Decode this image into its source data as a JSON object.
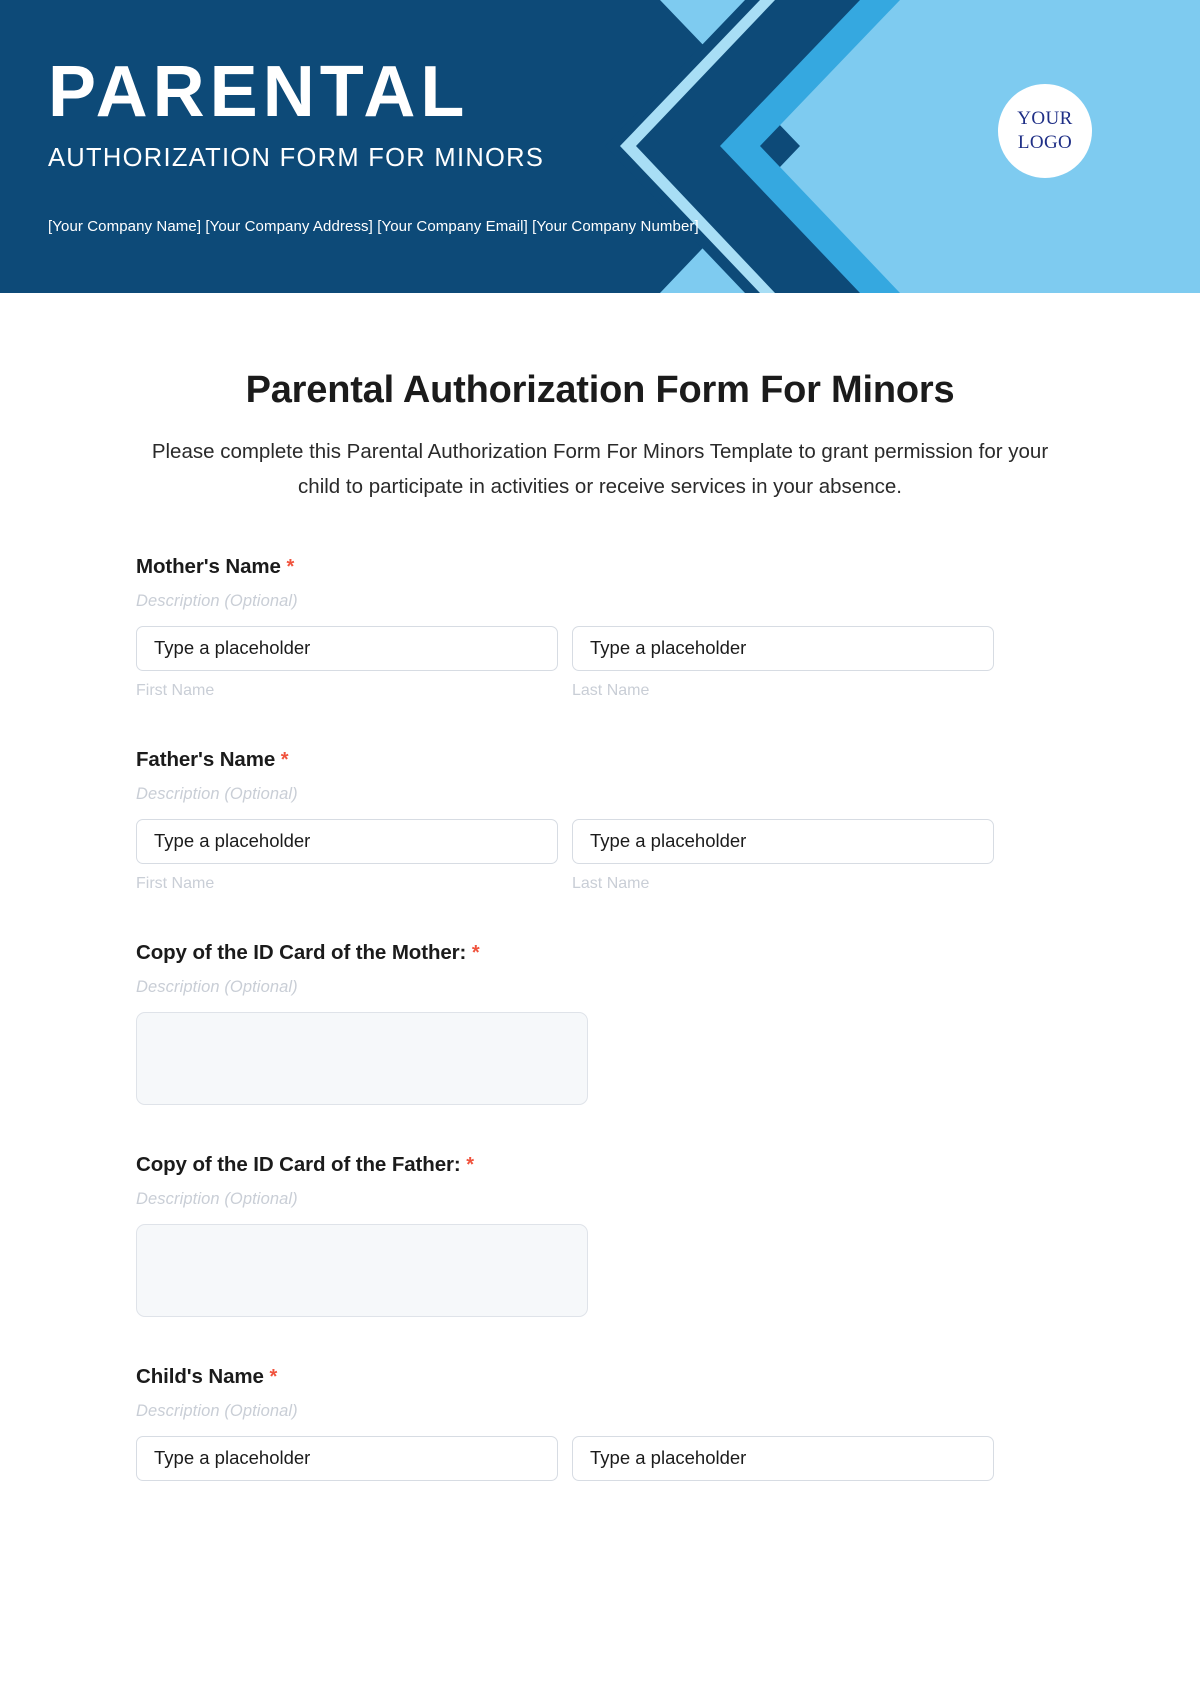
{
  "header": {
    "brand_title": "PARENTAL",
    "brand_subtitle": "AUTHORIZATION FORM FOR MINORS",
    "company_info": "[Your Company Name] [Your Company Address] [Your Company Email] [Your Company Number]",
    "logo_line1": "YOUR",
    "logo_line2": "LOGO",
    "colors": {
      "dark_blue": "#0d4a78",
      "mid_blue": "#35a8e0",
      "light_blue": "#7ecbf0",
      "pale_blue": "#a8def5"
    }
  },
  "form": {
    "title": "Parental Authorization Form For Minors",
    "description": "Please complete this Parental Authorization Form For Minors Template to grant permission for your child to participate in activities or receive services in your absence.",
    "required_marker": "*",
    "optional_description": "Description (Optional)",
    "placeholder": "Type a placeholder",
    "sub_labels": {
      "first_name": "First Name",
      "last_name": "Last Name"
    },
    "fields": [
      {
        "label": "Mother's Name",
        "type": "name"
      },
      {
        "label": "Father's Name",
        "type": "name"
      },
      {
        "label": "Copy of the ID Card of the Mother:",
        "type": "upload"
      },
      {
        "label": "Copy of the ID Card of the Father:",
        "type": "upload"
      },
      {
        "label": "Child's Name",
        "type": "name"
      }
    ]
  }
}
